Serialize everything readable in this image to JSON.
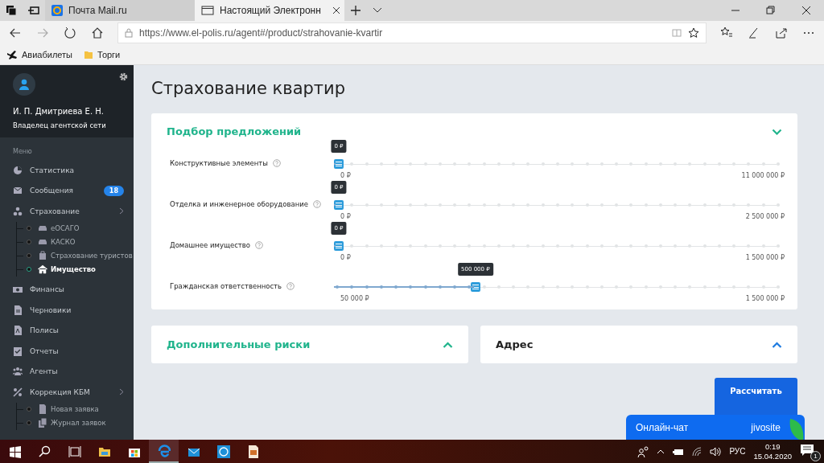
{
  "browser": {
    "tabs": [
      {
        "title": "Почта Mail.ru",
        "selected": false
      },
      {
        "title": "Настоящий Электронн",
        "selected": true
      }
    ],
    "url": "https://www.el-polis.ru/agent#/product/strahovanie-kvartir",
    "bookmarks": [
      "Авиабилеты",
      "Торги"
    ]
  },
  "sidebar": {
    "user_name": "И. П. Дмитриева Е. Н.",
    "user_role": "Владелец агентской сети",
    "menu_heading": "Меню",
    "items": [
      {
        "label": "Статистика"
      },
      {
        "label": "Сообщения",
        "badge": "18"
      },
      {
        "label": "Страхование",
        "children": [
          {
            "label": "еОСАГО",
            "selected": false
          },
          {
            "label": "КАСКО",
            "selected": false
          },
          {
            "label": "Страхование туристов",
            "selected": false
          },
          {
            "label": "Имущество",
            "selected": true
          }
        ]
      },
      {
        "label": "Финансы"
      },
      {
        "label": "Черновики"
      },
      {
        "label": "Полисы"
      },
      {
        "label": "Отчеты"
      },
      {
        "label": "Агенты"
      },
      {
        "label": "Коррекция КБМ",
        "children": [
          {
            "label": "Новая заявка",
            "selected": false
          },
          {
            "label": "Журнал заявок",
            "selected": false
          }
        ]
      }
    ]
  },
  "page": {
    "title": "Страхование квартир",
    "offers_panel": {
      "title": "Подбор предложений",
      "expanded": true,
      "sliders": [
        {
          "label": "Конструктивные элементы",
          "tooltip": "0 ₽",
          "min": "0 ₽",
          "max": "11 000 000 ₽",
          "level": 0
        },
        {
          "label": "Отделка и инженерное оборудование",
          "tooltip": "0 ₽",
          "min": "0 ₽",
          "max": "2 500 000 ₽",
          "level": 0
        },
        {
          "label": "Домашнее имущество",
          "tooltip": "0 ₽",
          "min": "0 ₽",
          "max": "1 500 000 ₽",
          "level": 0
        },
        {
          "label": "Гражданская ответственность",
          "tooltip": "500 000 ₽",
          "min": "50 000 ₽",
          "max": "1 500 000 ₽",
          "level": 0.31
        }
      ]
    },
    "panels": [
      {
        "title": "Дополнительные риски",
        "kind": "accent",
        "expanded": false
      },
      {
        "title": "Адрес",
        "kind": "plain",
        "expanded": false
      }
    ],
    "calculate_button": "Рассчитать"
  },
  "chat": {
    "label": "Онлайн-чат",
    "brand": "jivosite"
  },
  "taskbar": {
    "language": "РУС",
    "time": "0:19",
    "date": "15.04.2020",
    "notifications": "1"
  }
}
